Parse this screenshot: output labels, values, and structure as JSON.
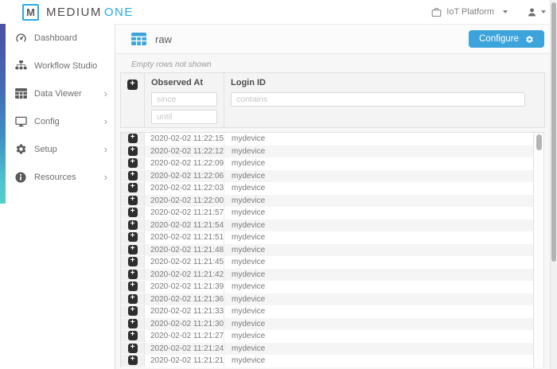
{
  "brand": {
    "logo_letter": "M",
    "name_part1": "MEDIUM",
    "name_part2": "ONE",
    "accent_blue": "#29abe2"
  },
  "topbar": {
    "context_menu": "IoT Platform"
  },
  "sidebar": {
    "submenu_arrow": "›",
    "items": [
      {
        "label": "Dashboard",
        "icon": "dashboard-icon",
        "has_submenu": false
      },
      {
        "label": "Workflow Studio",
        "icon": "workflow-icon",
        "has_submenu": false
      },
      {
        "label": "Data Viewer",
        "icon": "data-table-icon",
        "has_submenu": true
      },
      {
        "label": "Config",
        "icon": "monitor-icon",
        "has_submenu": true
      },
      {
        "label": "Setup",
        "icon": "gear-icon",
        "has_submenu": true
      },
      {
        "label": "Resources",
        "icon": "info-icon",
        "has_submenu": true
      }
    ]
  },
  "main": {
    "title": "raw",
    "configure_button": "Configure",
    "note": "Empty rows not shown",
    "table": {
      "columns": {
        "observed_at": "Observed At",
        "login_id": "Login ID"
      },
      "filters": {
        "since": "since",
        "until": "until",
        "contains": "contains"
      },
      "rows": [
        {
          "observed_at": "2020-02-02 11:22:15",
          "login_id": "mydevice"
        },
        {
          "observed_at": "2020-02-02 11:22:12",
          "login_id": "mydevice"
        },
        {
          "observed_at": "2020-02-02 11:22:09",
          "login_id": "mydevice"
        },
        {
          "observed_at": "2020-02-02 11:22:06",
          "login_id": "mydevice"
        },
        {
          "observed_at": "2020-02-02 11:22:03",
          "login_id": "mydevice"
        },
        {
          "observed_at": "2020-02-02 11:22:00",
          "login_id": "mydevice"
        },
        {
          "observed_at": "2020-02-02 11:21:57",
          "login_id": "mydevice"
        },
        {
          "observed_at": "2020-02-02 11:21:54",
          "login_id": "mydevice"
        },
        {
          "observed_at": "2020-02-02 11:21:51",
          "login_id": "mydevice"
        },
        {
          "observed_at": "2020-02-02 11:21:48",
          "login_id": "mydevice"
        },
        {
          "observed_at": "2020-02-02 11:21:45",
          "login_id": "mydevice"
        },
        {
          "observed_at": "2020-02-02 11:21:42",
          "login_id": "mydevice"
        },
        {
          "observed_at": "2020-02-02 11:21:39",
          "login_id": "mydevice"
        },
        {
          "observed_at": "2020-02-02 11:21:36",
          "login_id": "mydevice"
        },
        {
          "observed_at": "2020-02-02 11:21:33",
          "login_id": "mydevice"
        },
        {
          "observed_at": "2020-02-02 11:21:30",
          "login_id": "mydevice"
        },
        {
          "observed_at": "2020-02-02 11:21:27",
          "login_id": "mydevice"
        },
        {
          "observed_at": "2020-02-02 11:21:24",
          "login_id": "mydevice"
        },
        {
          "observed_at": "2020-02-02 11:21:21",
          "login_id": "mydevice"
        }
      ]
    }
  },
  "colors": {
    "accent_blue": "#29abe2",
    "button_blue": "#3ca4db",
    "strip_gradient_top": "#4d4fa5",
    "strip_gradient_bottom": "#55cfc9"
  }
}
